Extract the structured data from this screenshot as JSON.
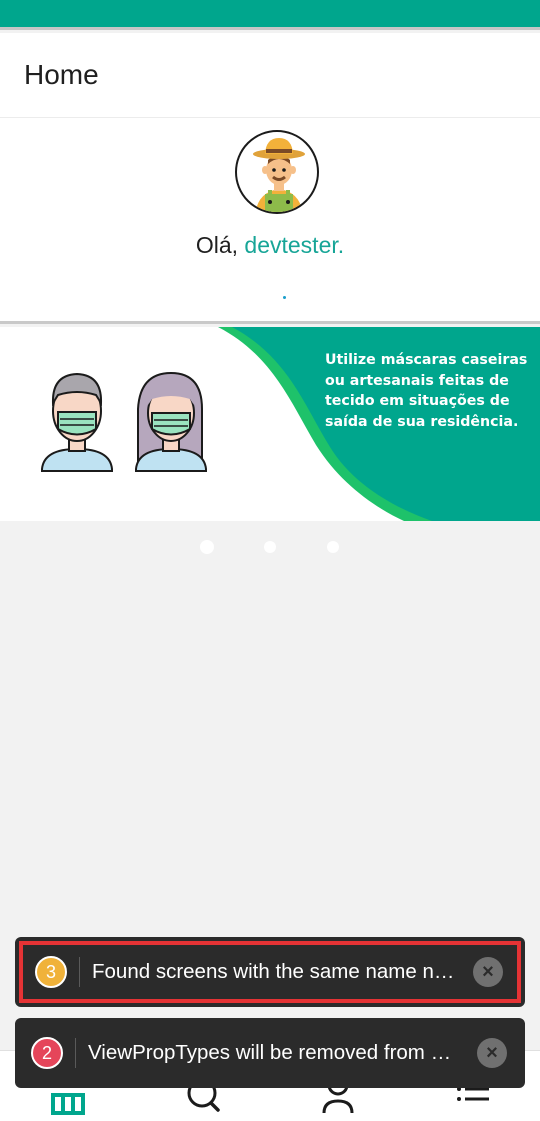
{
  "colors": {
    "primary": "#00a68d",
    "username": "#17a597",
    "banner_green": "#00a68d",
    "banner_wave": "#1ec26a",
    "toast_bg": "#2b2b2b",
    "highlight_border": "#e53335",
    "badge_warning": "#f0b23a",
    "badge_error": "#e5455a"
  },
  "header": {
    "title": "Home"
  },
  "profile": {
    "avatar_icon": "farmer-avatar-icon",
    "greeting_prefix": "Olá, ",
    "username": "devtester."
  },
  "banner": {
    "text": "Utilize máscaras caseiras\nou  artesanais feitas de\ntecido em situações de\nsaída de sua residência.",
    "illustration": "people-with-masks-icon"
  },
  "carousel": {
    "total_slides": 3,
    "active_index": 0
  },
  "bottom_nav": {
    "items": [
      {
        "icon": "home-icon",
        "active": true
      },
      {
        "icon": "search-icon",
        "active": false
      },
      {
        "icon": "user-icon",
        "active": false
      },
      {
        "icon": "menu-icon",
        "active": false
      }
    ]
  },
  "toasts": [
    {
      "count": "3",
      "message": "Found screens with the same name nested inside one another. Check:",
      "badge_color": "#f0b23a",
      "highlighted": true
    },
    {
      "count": "2",
      "message": "ViewPropTypes will be removed from React Native.",
      "badge_color": "#e5455a",
      "highlighted": false
    }
  ]
}
